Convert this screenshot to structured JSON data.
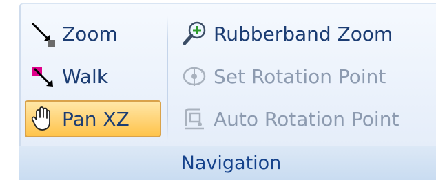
{
  "group": {
    "label": "Navigation"
  },
  "buttons": {
    "zoom": {
      "label": "Zoom",
      "icon": "zoom-arrow-icon"
    },
    "walk": {
      "label": "Walk",
      "icon": "walk-arrow-icon"
    },
    "pan": {
      "label": "Pan XZ",
      "icon": "hand-icon",
      "state": "selected"
    },
    "rubberband_zoom": {
      "label": "Rubberband Zoom",
      "icon": "magnifier-plus-icon"
    },
    "set_rotation_point": {
      "label": "Set Rotation Point",
      "icon": "rotation-point-icon",
      "state": "disabled"
    },
    "auto_rotation_point": {
      "label": "Auto Rotation Point",
      "icon": "auto-rotation-icon",
      "state": "disabled"
    }
  },
  "colors": {
    "label_text": "#15428b",
    "button_text": "#1c3d73",
    "disabled_text": "#8d9bb0",
    "active_fill": "#ffd57a",
    "active_border": "#d9a24a"
  }
}
